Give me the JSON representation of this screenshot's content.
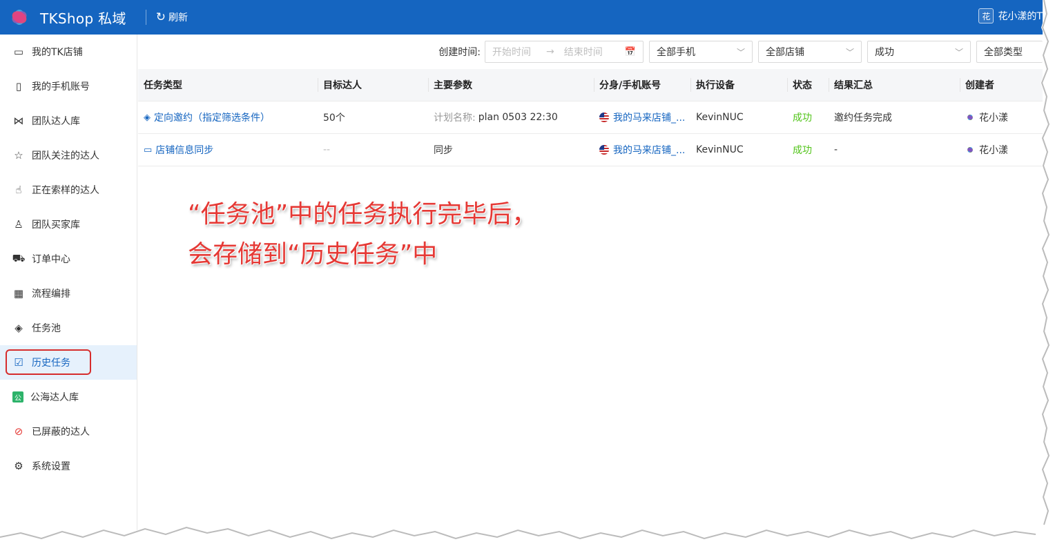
{
  "app": {
    "brand": "TKShop 私域",
    "refresh_label": "刷新",
    "user_badge": "花",
    "user_name": "花小漾的T"
  },
  "sidebar": {
    "items": [
      {
        "label": "我的TK店铺",
        "icon": "store-icon",
        "glyph": "▭"
      },
      {
        "label": "我的手机账号",
        "icon": "phone-icon",
        "glyph": "▯"
      },
      {
        "label": "团队达人库",
        "icon": "bow-icon",
        "glyph": "⋈"
      },
      {
        "label": "团队关注的达人",
        "icon": "star-icon",
        "glyph": "☆"
      },
      {
        "label": "正在索样的达人",
        "icon": "hand-pointer-icon",
        "glyph": "☝"
      },
      {
        "label": "团队买家库",
        "icon": "user-icon",
        "glyph": "♙"
      },
      {
        "label": "订单中心",
        "icon": "truck-icon",
        "glyph": "⛟"
      },
      {
        "label": "流程编排",
        "icon": "calendar-icon",
        "glyph": "▦"
      },
      {
        "label": "任务池",
        "icon": "layers-icon",
        "glyph": "◈"
      },
      {
        "label": "历史任务",
        "icon": "clipboard-check-icon",
        "glyph": "☑"
      },
      {
        "label": "公海达人库",
        "icon": "public-badge-icon",
        "glyph": "公"
      },
      {
        "label": "已屏蔽的达人",
        "icon": "block-icon",
        "glyph": "⊘"
      },
      {
        "label": "系统设置",
        "icon": "gear-icon",
        "glyph": "⚙"
      }
    ],
    "active_index": 9
  },
  "filters": {
    "created_label": "创建时间:",
    "start_placeholder": "开始时间",
    "end_placeholder": "结束时间",
    "phone": "全部手机",
    "shop": "全部店铺",
    "status": "成功",
    "type": "全部类型"
  },
  "table": {
    "headers": [
      "任务类型",
      "目标达人",
      "主要参数",
      "分身/手机账号",
      "执行设备",
      "状态",
      "结果汇总",
      "创建者"
    ],
    "rows": [
      {
        "type": "定向邀约（指定筛选条件）",
        "type_icon": "tag-icon",
        "target": "50个",
        "param_label": "计划名称:",
        "param_value": "plan 0503 22:30",
        "account": "我的马来店铺_...",
        "device": "KevinNUC",
        "status": "成功",
        "result": "邀约任务完成",
        "creator": "花小漾"
      },
      {
        "type": "店铺信息同步",
        "type_icon": "store-icon",
        "target": "--",
        "param_label": "",
        "param_value": "同步",
        "account": "我的马来店铺_...",
        "device": "KevinNUC",
        "status": "成功",
        "result": "-",
        "creator": "花小漾"
      }
    ]
  },
  "annotation": {
    "line1": "“任务池”中的任务执行完毕后，",
    "line2": "会存储到“历史任务”中"
  },
  "colors": {
    "header_bg": "#1565c0",
    "link": "#1565c0",
    "success": "#52c41a",
    "annotation": "#e53935",
    "highlight_box": "#d62c2c"
  }
}
